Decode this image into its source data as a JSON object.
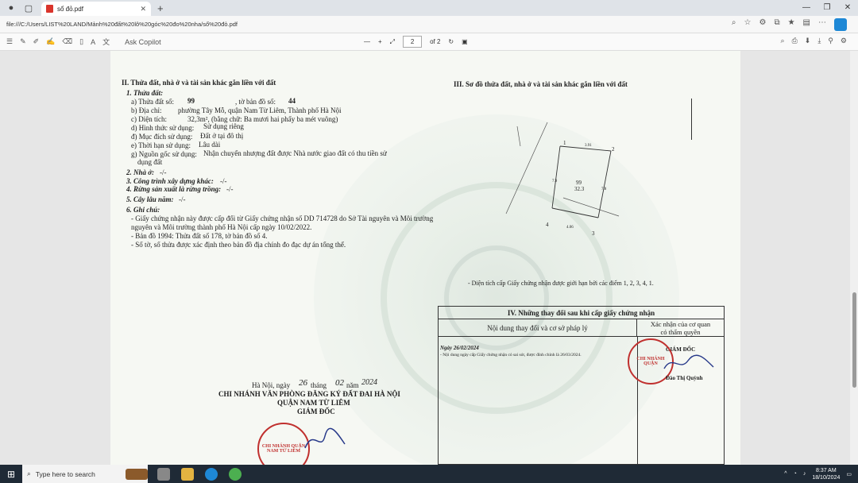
{
  "browser": {
    "tab_title": "sổ đỏ.pdf",
    "url": "file:///C:/Users/LIST%20LAND/Mảnh%20đất%20lô%20góc%20đo%20nha/sổ%20đỏ.pdf"
  },
  "pdf_toolbar": {
    "copilot_label": "Ask Copilot",
    "page_number": "2",
    "page_total": "of 2"
  },
  "document": {
    "section2": {
      "heading": "II. Thửa đất, nhà ở và tài sản khác gắn liền với đất",
      "land_label": "1. Thửa đất:",
      "a_label": "a) Thửa đất số:",
      "a_value": "99",
      "a_map": ", tờ bản đồ số:",
      "a_map_value": "44",
      "b_label": "b) Địa chỉ:",
      "b_value": "phường Tây Mỗ, quận Nam Từ Liêm, Thành phố Hà Nội",
      "c_label": "c) Diện tích:",
      "c_value": "32,3m², (bằng chữ: Ba mươi hai phẩy ba mét vuông)",
      "d_label": "d) Hình thức sử dụng:",
      "d_value": "Sử dụng riêng",
      "dd_label": "đ) Mục đích sử dụng:",
      "dd_value": "Đất ở tại đô thị",
      "e_label": "e) Thời hạn sử dụng:",
      "e_value": "Lâu dài",
      "g_label": "g) Nguồn gốc sử dụng:",
      "g_value": "Nhận chuyển nhượng đất được Nhà nước giao đất có thu tiền sử",
      "g_value2": "dụng đất",
      "house": "2. Nhà ở:",
      "house_value": "-/-",
      "works": "3. Công trình xây dựng khác:",
      "works_value": "-/-",
      "forest": "4. Rừng sản xuất là rừng trồng:",
      "forest_value": "-/-",
      "trees": "5. Cây lâu năm:",
      "trees_value": "-/-",
      "notes": "6. Ghi chú:",
      "note1": "- Giấy chứng nhận này được cấp đổi từ Giấy chứng nhận số DD 714728 do Sở Tài nguyên và Môi trường",
      "note1b": "nguyên và Môi trường thành phố Hà Nội cấp ngày 10/02/2022.",
      "note2": "- Bản đồ 1994: Thửa đất số 178, tờ bản đồ số 4.",
      "note3": "- Số tờ, số thửa được xác định theo bản đồ địa chính đo đạc dự án tổng thể."
    },
    "signature": {
      "place_date_prefix": "Hà Nội, ngày",
      "day": "26",
      "month_label": "tháng",
      "month": "02",
      "year_label": "năm",
      "year": "2024",
      "org1": "CHI NHÁNH VĂN PHÒNG ĐĂNG KÝ ĐẤT ĐAI HÀ NỘI",
      "org2": "QUẬN NAM TỪ LIÊM",
      "role": "GIÁM ĐỐC",
      "stamp_text": "CHI NHÁNH QUẬN NAM TỪ LIÊM"
    },
    "section3": {
      "heading": "III. Sơ đồ thửa đất, nhà ở và tài sản khác gắn liền với đất",
      "parcel_no": "99",
      "parcel_area": "32.3",
      "point1": "1",
      "point2": "2",
      "point3": "3",
      "point4": "4",
      "edge_top": "3.91",
      "edge_left": "7.9",
      "edge_right": "7.8",
      "edge_bottom": "4.06",
      "caption": "- Diện tích cấp Giấy chứng nhận được giới hạn bởi các điểm 1, 2, 3, 4, 1."
    },
    "section4": {
      "heading": "IV. Những thay đổi sau khi cấp giấy chứng nhận",
      "col1": "Nội dung thay đổi và cơ sở pháp lý",
      "col2a": "Xác nhận của cơ quan",
      "col2b": "có thẩm quyền",
      "entry_date": "Ngày 26/02/2024",
      "entry_text": "- Nội dung ngày cấp Giấy chứng nhận có sai sót, được đính chính là 26/03/2024.",
      "sign_role": "GIÁM ĐỐC",
      "sign_name": "Đào Thị Quỳnh",
      "stamp_text": "CHI NHÁNH QUẬN"
    }
  },
  "taskbar": {
    "search_placeholder": "Type here to search",
    "time": "8:37 AM",
    "date": "18/10/2024"
  }
}
